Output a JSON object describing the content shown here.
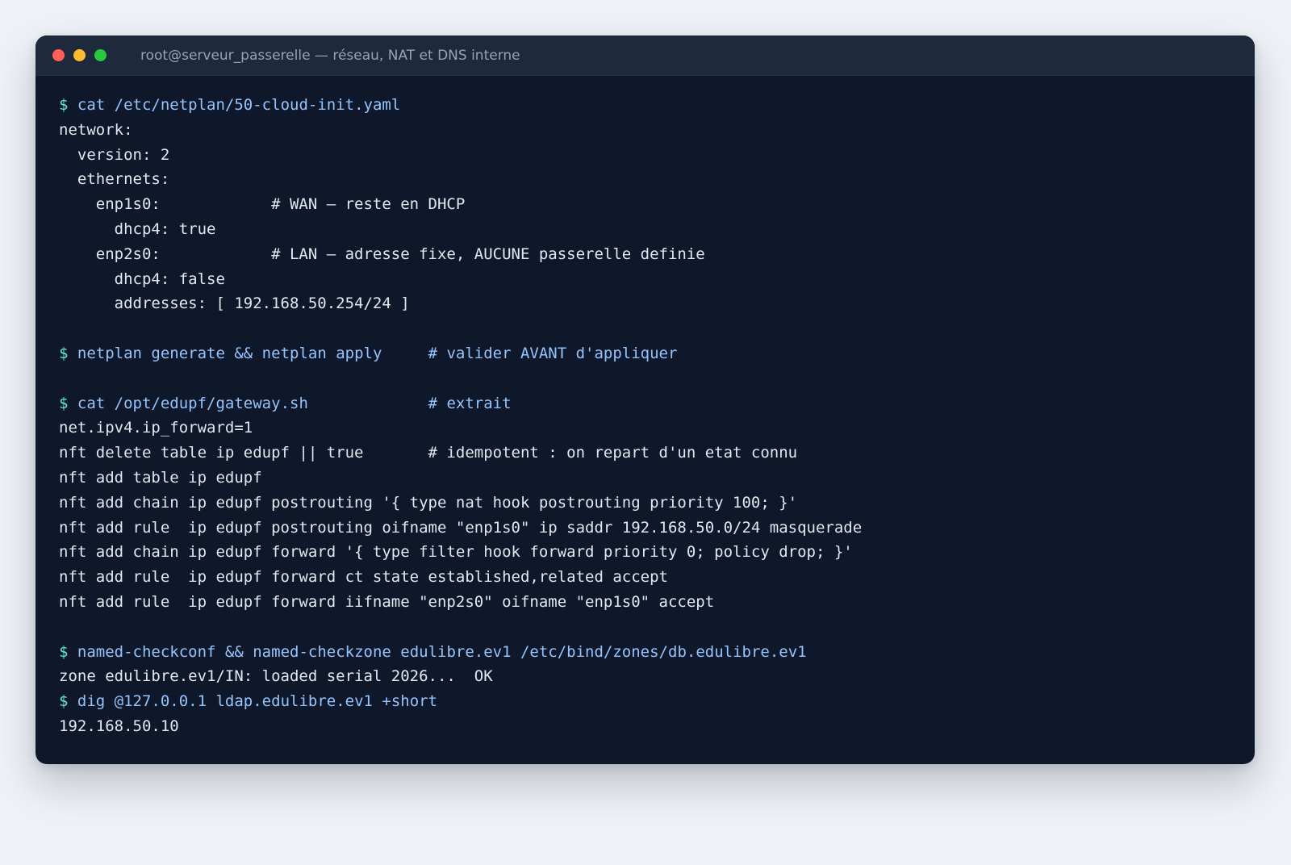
{
  "window": {
    "title": "root@serveur_passerelle — réseau, NAT et DNS interne",
    "controls": {
      "close_color": "#ff5f57",
      "minimize_color": "#febc2e",
      "maximize_color": "#28c840"
    }
  },
  "colors": {
    "background": "#0f172a",
    "title_bar": "#1e293b",
    "command_text": "#93c5fd",
    "prompt_sign": "#5eead4",
    "output_text": "#e2e8f0"
  },
  "terminal": {
    "prompt": "$",
    "lines": [
      {
        "type": "command",
        "text": "cat /etc/netplan/50-cloud-init.yaml"
      },
      {
        "type": "output",
        "text": "network:"
      },
      {
        "type": "output",
        "text": "  version: 2"
      },
      {
        "type": "output",
        "text": "  ethernets:"
      },
      {
        "type": "output",
        "text": "    enp1s0:            # WAN — reste en DHCP"
      },
      {
        "type": "output",
        "text": "      dhcp4: true"
      },
      {
        "type": "output",
        "text": "    enp2s0:            # LAN — adresse fixe, AUCUNE passerelle definie"
      },
      {
        "type": "output",
        "text": "      dhcp4: false"
      },
      {
        "type": "output",
        "text": "      addresses: [ 192.168.50.254/24 ]"
      },
      {
        "type": "blank",
        "text": ""
      },
      {
        "type": "command",
        "text": "netplan generate && netplan apply     # valider AVANT d'appliquer"
      },
      {
        "type": "blank",
        "text": ""
      },
      {
        "type": "command",
        "text": "cat /opt/edupf/gateway.sh             # extrait"
      },
      {
        "type": "output",
        "text": "net.ipv4.ip_forward=1"
      },
      {
        "type": "output",
        "text": "nft delete table ip edupf || true       # idempotent : on repart d'un etat connu"
      },
      {
        "type": "output",
        "text": "nft add table ip edupf"
      },
      {
        "type": "output",
        "text": "nft add chain ip edupf postrouting '{ type nat hook postrouting priority 100; }'"
      },
      {
        "type": "output",
        "text": "nft add rule  ip edupf postrouting oifname \"enp1s0\" ip saddr 192.168.50.0/24 masquerade"
      },
      {
        "type": "output",
        "text": "nft add chain ip edupf forward '{ type filter hook forward priority 0; policy drop; }'"
      },
      {
        "type": "output",
        "text": "nft add rule  ip edupf forward ct state established,related accept"
      },
      {
        "type": "output",
        "text": "nft add rule  ip edupf forward iifname \"enp2s0\" oifname \"enp1s0\" accept"
      },
      {
        "type": "blank",
        "text": ""
      },
      {
        "type": "command",
        "text": "named-checkconf && named-checkzone edulibre.ev1 /etc/bind/zones/db.edulibre.ev1"
      },
      {
        "type": "output",
        "text": "zone edulibre.ev1/IN: loaded serial 2026...  OK"
      },
      {
        "type": "command",
        "text": "dig @127.0.0.1 ldap.edulibre.ev1 +short"
      },
      {
        "type": "output",
        "text": "192.168.50.10"
      }
    ]
  }
}
